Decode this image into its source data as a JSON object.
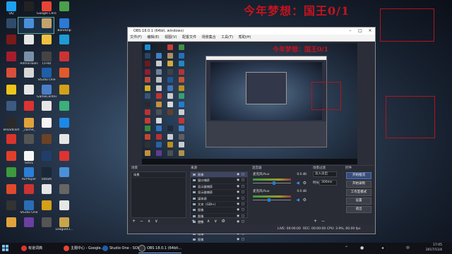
{
  "banner": {
    "text": "今年梦想：国王0/1"
  },
  "desktop": {
    "icons": [
      {
        "label": "QQ",
        "color": "#1da1f2"
      },
      {
        "label": "",
        "color": "#2f4b6a"
      },
      {
        "label": "",
        "color": "#7a1a1a"
      },
      {
        "label": "",
        "color": "#a51d2d"
      },
      {
        "label": "",
        "color": "#d94f3a"
      },
      {
        "label": "",
        "color": "#f0c419"
      },
      {
        "label": "",
        "color": "#3d5a80"
      },
      {
        "label": "Broadcast",
        "color": "#2a2a2a"
      },
      {
        "label": "",
        "color": "#d9342b"
      },
      {
        "label": "",
        "color": "#e23f2b"
      },
      {
        "label": "",
        "color": "#3c9a3c"
      },
      {
        "label": "",
        "color": "#e04a2c"
      },
      {
        "label": "",
        "color": "#333"
      },
      {
        "label": "",
        "color": "#e0a33b"
      },
      {
        "label": "",
        "color": "#222"
      },
      {
        "label": "",
        "color": "#4a90d9"
      },
      {
        "label": "",
        "color": "#e6e6e6"
      },
      {
        "label": "AdminTools",
        "color": "#7a8fa8"
      },
      {
        "label": "",
        "color": "#d7d7d7"
      },
      {
        "label": "",
        "color": "#e6e6e6"
      },
      {
        "label": "",
        "color": "#d33"
      },
      {
        "label": "_cache_",
        "color": "#e0a33b"
      },
      {
        "label": "",
        "color": "#555"
      },
      {
        "label": "SOUL",
        "color": "#f6f6f6"
      },
      {
        "label": "AirPlayer",
        "color": "#2b7fd6"
      },
      {
        "label": "",
        "color": "#c33"
      },
      {
        "label": "Studio One",
        "color": "#2a6db5"
      },
      {
        "label": "",
        "color": "#6b3fa0"
      },
      {
        "label": "Google Chrome",
        "color": "#ea4335"
      },
      {
        "label": "",
        "color": "#c3a36b"
      },
      {
        "label": "",
        "color": "#f0c040"
      },
      {
        "label": "CFHD",
        "color": "#444"
      },
      {
        "label": "Studio One",
        "color": "#1f5ea8"
      },
      {
        "label": "GameCenter",
        "color": "#4a7fc8"
      },
      {
        "label": "",
        "color": "#e6e6e6"
      },
      {
        "label": "",
        "color": "#f5f5f5"
      },
      {
        "label": "",
        "color": "#6b4226"
      },
      {
        "label": "",
        "color": "#1f3f6a"
      },
      {
        "label": "Steam",
        "color": "#1b2838"
      },
      {
        "label": "",
        "color": "#e6e6e6"
      },
      {
        "label": "",
        "color": "#d4a017"
      },
      {
        "label": "",
        "color": "#555"
      },
      {
        "label": "",
        "color": "#4ba04b"
      },
      {
        "label": "Bandizip",
        "color": "#2a7ad6"
      },
      {
        "label": "",
        "color": "#1f9ad6"
      },
      {
        "label": "",
        "color": "#c33"
      },
      {
        "label": "",
        "color": "#e25a2c"
      },
      {
        "label": "",
        "color": "#d4a017"
      },
      {
        "label": "",
        "color": "#3ab07a"
      },
      {
        "label": "",
        "color": "#1e88e5"
      },
      {
        "label": "",
        "color": "#e6e6e6"
      },
      {
        "label": "",
        "color": "#d33"
      },
      {
        "label": "",
        "color": "#4a90d9"
      },
      {
        "label": "",
        "color": "#666"
      },
      {
        "label": "",
        "color": "#e6e6e6"
      },
      {
        "label": "LeagueCl...",
        "color": "#c9a44a"
      }
    ]
  },
  "obs": {
    "title": "OBS 18.0.1 (64bit, windows)",
    "menu": [
      "文件(F)",
      "编辑(E)",
      "视图(V)",
      "配置文件",
      "场景集合",
      "工具(T)",
      "帮助(H)"
    ],
    "nested_banner": "今年梦想：国王0/1",
    "panels": {
      "scenes": {
        "header": "场景",
        "items": [
          "场景"
        ]
      },
      "sources": {
        "header": "来源",
        "items": [
          "图像",
          "窗口捕获",
          "显示器捕获",
          "显示器捕获",
          "媒体源",
          "文本（GDI+）",
          "图像",
          "图像",
          "图像",
          "图像",
          "图像",
          "图像"
        ]
      },
      "mixer": {
        "header": "混音器",
        "channels": [
          {
            "name": "麦克风/Aux",
            "db": "0.0 dB",
            "level": 0.55
          },
          {
            "name": "麦克风/Aux",
            "db": "0.0 dB",
            "level": 0.4
          }
        ]
      },
      "transitions": {
        "header": "场景过渡",
        "type_value": "淡入淡出",
        "duration_label": "时长",
        "duration_value": "300ms"
      },
      "controls": {
        "header": "控件",
        "buttons": [
          "开始推流",
          "开始录制",
          "工作室模式",
          "设置",
          "退出"
        ]
      }
    },
    "footer_glyphs": "+ − ∧ ∨",
    "status": {
      "live": "LIVE: 00:00:00",
      "rec": "REC: 00:00:00",
      "cpu": "CPU: 3.9%, 60.00 fps"
    }
  },
  "taskbar": {
    "tasks": [
      {
        "label": "有道词典",
        "color": "#d33"
      },
      {
        "label": "主题中心 - Google...",
        "color": "#ea4335"
      },
      {
        "label": "Studio One - SOUL",
        "color": "#1f5ea8"
      },
      {
        "label": "OBS 18.0.1 (64bit...",
        "color": "#333"
      }
    ],
    "tray_lang": "中",
    "time": "17:05",
    "date": "2017/11/4"
  }
}
